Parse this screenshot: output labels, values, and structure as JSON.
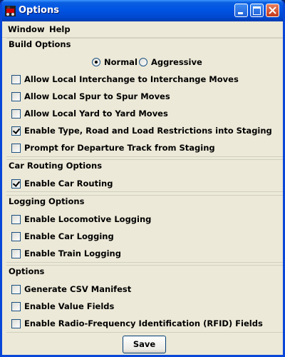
{
  "window": {
    "title": "Options"
  },
  "menubar": {
    "items": [
      "Window",
      "Help"
    ]
  },
  "build_options": {
    "title": "Build Options",
    "mode": {
      "normal": "Normal",
      "aggressive": "Aggressive",
      "selected": "Normal"
    },
    "items": [
      {
        "label": "Allow Local Interchange to Interchange Moves",
        "checked": false
      },
      {
        "label": "Allow Local Spur to Spur Moves",
        "checked": false
      },
      {
        "label": "Allow Local Yard to Yard Moves",
        "checked": false
      },
      {
        "label": "Enable Type, Road and Load Restrictions into Staging",
        "checked": true
      },
      {
        "label": "Prompt for Departure Track from Staging",
        "checked": false
      }
    ]
  },
  "car_routing": {
    "title": "Car Routing Options",
    "items": [
      {
        "label": "Enable Car Routing",
        "checked": true
      }
    ]
  },
  "logging": {
    "title": "Logging Options",
    "items": [
      {
        "label": "Enable Locomotive Logging",
        "checked": false
      },
      {
        "label": "Enable Car Logging",
        "checked": false
      },
      {
        "label": "Enable Train Logging",
        "checked": false
      }
    ]
  },
  "options": {
    "title": "Options",
    "items": [
      {
        "label": "Generate CSV Manifest",
        "checked": false
      },
      {
        "label": "Enable Value Fields",
        "checked": false
      },
      {
        "label": "Enable Radio-Frequency Identification (RFID) Fields",
        "checked": false
      }
    ]
  },
  "save_label": "Save"
}
